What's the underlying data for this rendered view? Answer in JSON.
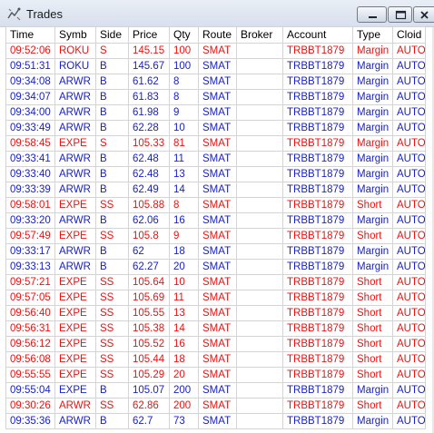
{
  "window": {
    "title": "Trades",
    "icon": "trades-window-icon"
  },
  "colors": {
    "red": "#ee1111",
    "blue": "#1a21c9"
  },
  "table": {
    "columns": [
      "Time",
      "Symb",
      "Side",
      "Price",
      "Qty",
      "Route",
      "Broker",
      "Account",
      "Type",
      "Cloid"
    ],
    "rows": [
      {
        "time": "09:52:06",
        "symb": "ROKU",
        "side": "S",
        "price": "145.15",
        "qty": "100",
        "route": "SMAT",
        "broker": "",
        "account": "TRBBT1879",
        "type": "Margin",
        "cloid": "AUTO",
        "color": "red"
      },
      {
        "time": "09:51:31",
        "symb": "ROKU",
        "side": "B",
        "price": "145.67",
        "qty": "100",
        "route": "SMAT",
        "broker": "",
        "account": "TRBBT1879",
        "type": "Margin",
        "cloid": "AUTO",
        "color": "blue"
      },
      {
        "time": "09:34:08",
        "symb": "ARWR",
        "side": "B",
        "price": "61.62",
        "qty": "8",
        "route": "SMAT",
        "broker": "",
        "account": "TRBBT1879",
        "type": "Margin",
        "cloid": "AUTO",
        "color": "blue"
      },
      {
        "time": "09:34:07",
        "symb": "ARWR",
        "side": "B",
        "price": "61.83",
        "qty": "8",
        "route": "SMAT",
        "broker": "",
        "account": "TRBBT1879",
        "type": "Margin",
        "cloid": "AUTO",
        "color": "blue"
      },
      {
        "time": "09:34:00",
        "symb": "ARWR",
        "side": "B",
        "price": "61.98",
        "qty": "9",
        "route": "SMAT",
        "broker": "",
        "account": "TRBBT1879",
        "type": "Margin",
        "cloid": "AUTO",
        "color": "blue"
      },
      {
        "time": "09:33:49",
        "symb": "ARWR",
        "side": "B",
        "price": "62.28",
        "qty": "10",
        "route": "SMAT",
        "broker": "",
        "account": "TRBBT1879",
        "type": "Margin",
        "cloid": "AUTO",
        "color": "blue"
      },
      {
        "time": "09:58:45",
        "symb": "EXPE",
        "side": "S",
        "price": "105.33",
        "qty": "81",
        "route": "SMAT",
        "broker": "",
        "account": "TRBBT1879",
        "type": "Margin",
        "cloid": "AUTO",
        "color": "red"
      },
      {
        "time": "09:33:41",
        "symb": "ARWR",
        "side": "B",
        "price": "62.48",
        "qty": "11",
        "route": "SMAT",
        "broker": "",
        "account": "TRBBT1879",
        "type": "Margin",
        "cloid": "AUTO",
        "color": "blue"
      },
      {
        "time": "09:33:40",
        "symb": "ARWR",
        "side": "B",
        "price": "62.48",
        "qty": "13",
        "route": "SMAT",
        "broker": "",
        "account": "TRBBT1879",
        "type": "Margin",
        "cloid": "AUTO",
        "color": "blue"
      },
      {
        "time": "09:33:39",
        "symb": "ARWR",
        "side": "B",
        "price": "62.49",
        "qty": "14",
        "route": "SMAT",
        "broker": "",
        "account": "TRBBT1879",
        "type": "Margin",
        "cloid": "AUTO",
        "color": "blue"
      },
      {
        "time": "09:58:01",
        "symb": "EXPE",
        "side": "SS",
        "price": "105.88",
        "qty": "8",
        "route": "SMAT",
        "broker": "",
        "account": "TRBBT1879",
        "type": "Short",
        "cloid": "AUTO",
        "color": "red"
      },
      {
        "time": "09:33:20",
        "symb": "ARWR",
        "side": "B",
        "price": "62.06",
        "qty": "16",
        "route": "SMAT",
        "broker": "",
        "account": "TRBBT1879",
        "type": "Margin",
        "cloid": "AUTO",
        "color": "blue"
      },
      {
        "time": "09:57:49",
        "symb": "EXPE",
        "side": "SS",
        "price": "105.8",
        "qty": "9",
        "route": "SMAT",
        "broker": "",
        "account": "TRBBT1879",
        "type": "Short",
        "cloid": "AUTO",
        "color": "red"
      },
      {
        "time": "09:33:17",
        "symb": "ARWR",
        "side": "B",
        "price": "62",
        "qty": "18",
        "route": "SMAT",
        "broker": "",
        "account": "TRBBT1879",
        "type": "Margin",
        "cloid": "AUTO",
        "color": "blue"
      },
      {
        "time": "09:33:13",
        "symb": "ARWR",
        "side": "B",
        "price": "62.27",
        "qty": "20",
        "route": "SMAT",
        "broker": "",
        "account": "TRBBT1879",
        "type": "Margin",
        "cloid": "AUTO",
        "color": "blue"
      },
      {
        "time": "09:57:21",
        "symb": "EXPE",
        "side": "SS",
        "price": "105.64",
        "qty": "10",
        "route": "SMAT",
        "broker": "",
        "account": "TRBBT1879",
        "type": "Short",
        "cloid": "AUTO",
        "color": "red"
      },
      {
        "time": "09:57:05",
        "symb": "EXPE",
        "side": "SS",
        "price": "105.69",
        "qty": "11",
        "route": "SMAT",
        "broker": "",
        "account": "TRBBT1879",
        "type": "Short",
        "cloid": "AUTO",
        "color": "red"
      },
      {
        "time": "09:56:40",
        "symb": "EXPE",
        "side": "SS",
        "price": "105.55",
        "qty": "13",
        "route": "SMAT",
        "broker": "",
        "account": "TRBBT1879",
        "type": "Short",
        "cloid": "AUTO",
        "color": "red"
      },
      {
        "time": "09:56:31",
        "symb": "EXPE",
        "side": "SS",
        "price": "105.38",
        "qty": "14",
        "route": "SMAT",
        "broker": "",
        "account": "TRBBT1879",
        "type": "Short",
        "cloid": "AUTO",
        "color": "red"
      },
      {
        "time": "09:56:12",
        "symb": "EXPE",
        "side": "SS",
        "price": "105.52",
        "qty": "16",
        "route": "SMAT",
        "broker": "",
        "account": "TRBBT1879",
        "type": "Short",
        "cloid": "AUTO",
        "color": "red"
      },
      {
        "time": "09:56:08",
        "symb": "EXPE",
        "side": "SS",
        "price": "105.44",
        "qty": "18",
        "route": "SMAT",
        "broker": "",
        "account": "TRBBT1879",
        "type": "Short",
        "cloid": "AUTO",
        "color": "red"
      },
      {
        "time": "09:55:55",
        "symb": "EXPE",
        "side": "SS",
        "price": "105.29",
        "qty": "20",
        "route": "SMAT",
        "broker": "",
        "account": "TRBBT1879",
        "type": "Short",
        "cloid": "AUTO",
        "color": "red"
      },
      {
        "time": "09:55:04",
        "symb": "EXPE",
        "side": "B",
        "price": "105.07",
        "qty": "200",
        "route": "SMAT",
        "broker": "",
        "account": "TRBBT1879",
        "type": "Margin",
        "cloid": "AUTO",
        "color": "blue"
      },
      {
        "time": "09:30:26",
        "symb": "ARWR",
        "side": "SS",
        "price": "62.86",
        "qty": "200",
        "route": "SMAT",
        "broker": "",
        "account": "TRBBT1879",
        "type": "Short",
        "cloid": "AUTO",
        "color": "red"
      },
      {
        "time": "09:35:36",
        "symb": "ARWR",
        "side": "B",
        "price": "62.7",
        "qty": "73",
        "route": "SMAT",
        "broker": "",
        "account": "TRBBT1879",
        "type": "Margin",
        "cloid": "AUTO",
        "color": "blue"
      }
    ]
  }
}
